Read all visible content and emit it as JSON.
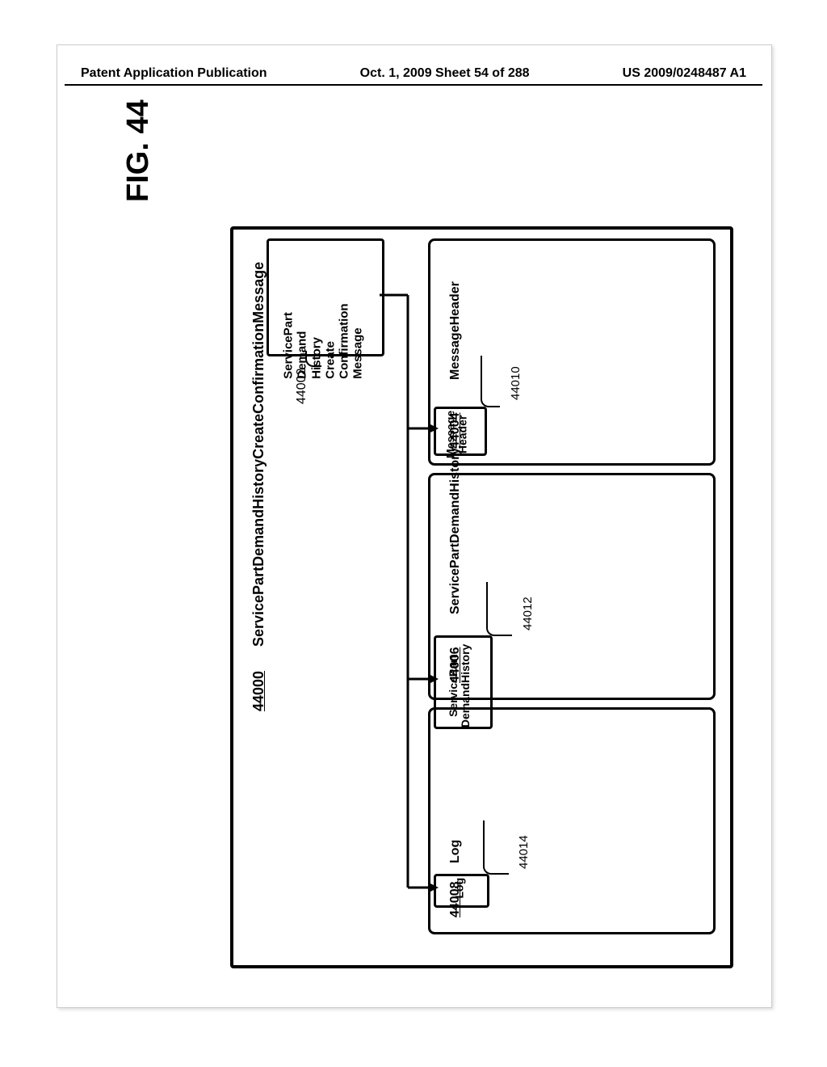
{
  "header": {
    "left": "Patent Application Publication",
    "center": "Oct. 1, 2009  Sheet 54 of 288",
    "right": "US 2009/0248487 A1"
  },
  "figure_label": "FIG. 44",
  "outer": {
    "ref": "44000",
    "title": "ServicePartDemandHistoryCreateConfirmationMessage"
  },
  "root": {
    "text": "ServicePart\nDemand\nHistory\nCreate\nConfirmation\nMessage",
    "ref": "44002"
  },
  "panels": [
    {
      "ref": "44004",
      "title": "MessageHeader",
      "child_text": "Message\nHeader",
      "child_ref": "44010"
    },
    {
      "ref": "44006",
      "title": "ServicePartDemandHistory",
      "child_text": "ServicePart\nDemandHistory",
      "child_ref": "44012"
    },
    {
      "ref": "44008",
      "title": "Log",
      "child_text": "Log",
      "child_ref": "44014"
    }
  ]
}
